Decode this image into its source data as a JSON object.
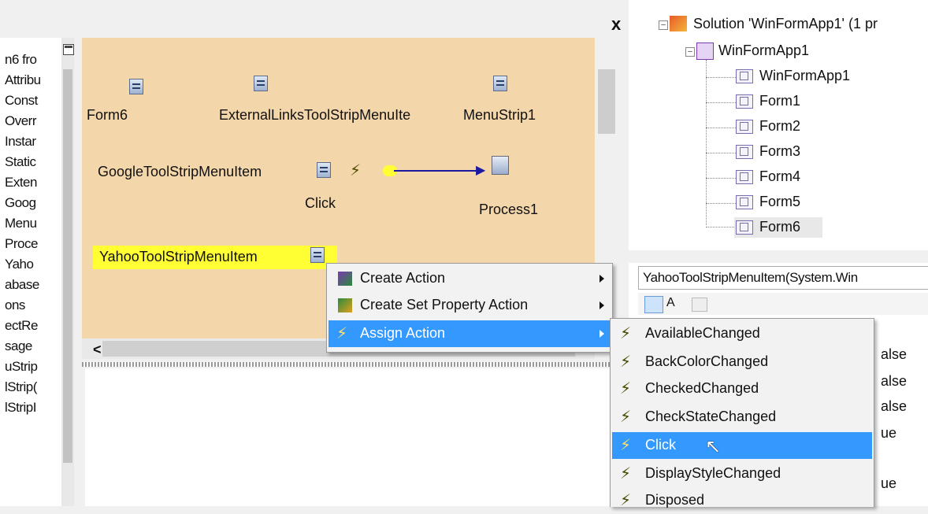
{
  "close_glyph": "x",
  "left_members": [
    "n6 fro",
    "Attribu",
    "Const",
    "Overr",
    "Instar",
    "Static",
    "Exten",
    "Goog",
    "Menu",
    "Proce",
    "Yaho",
    "abase",
    "ons",
    "ectRe",
    "sage",
    "uStrip",
    "lStrip(",
    "lStripI"
  ],
  "designer": {
    "form_label": "Form6",
    "links_label": "ExternalLinksToolStripMenuIte",
    "menustrip_label": "MenuStrip1",
    "google_label": "GoogleToolStripMenuItem",
    "click_label": "Click",
    "process_label": "Process1",
    "yahoo_label": "YahooToolStripMenuItem",
    "highlight_color": "#ffff33",
    "background_color": "#f4d6ab"
  },
  "hscroll_left_glyph": "<",
  "solution_explorer": {
    "solution": "Solution 'WinFormApp1' (1 pr",
    "project": "WinFormApp1",
    "items": [
      "WinFormApp1",
      "Form1",
      "Form2",
      "Form3",
      "Form4",
      "Form5",
      "Form6"
    ]
  },
  "properties": {
    "object": "YahooToolStripMenuItem(System.Win",
    "alpha_btn": "A",
    "values": [
      "alse",
      "alse",
      "alse",
      "ue",
      "ue"
    ]
  },
  "context_menu": {
    "items": [
      {
        "label": "Create Action"
      },
      {
        "label": "Create Set Property Action"
      },
      {
        "label": "Assign Action",
        "highlighted": true
      }
    ]
  },
  "submenu": {
    "items": [
      {
        "label": "AvailableChanged"
      },
      {
        "label": "BackColorChanged"
      },
      {
        "label": "CheckedChanged"
      },
      {
        "label": "CheckStateChanged"
      },
      {
        "label": "Click",
        "highlighted": true
      },
      {
        "label": "DisplayStyleChanged"
      },
      {
        "label": "Disposed"
      }
    ]
  },
  "colors": {
    "menu_highlight": "#3399ff",
    "link_line": "#1a1aa0"
  }
}
